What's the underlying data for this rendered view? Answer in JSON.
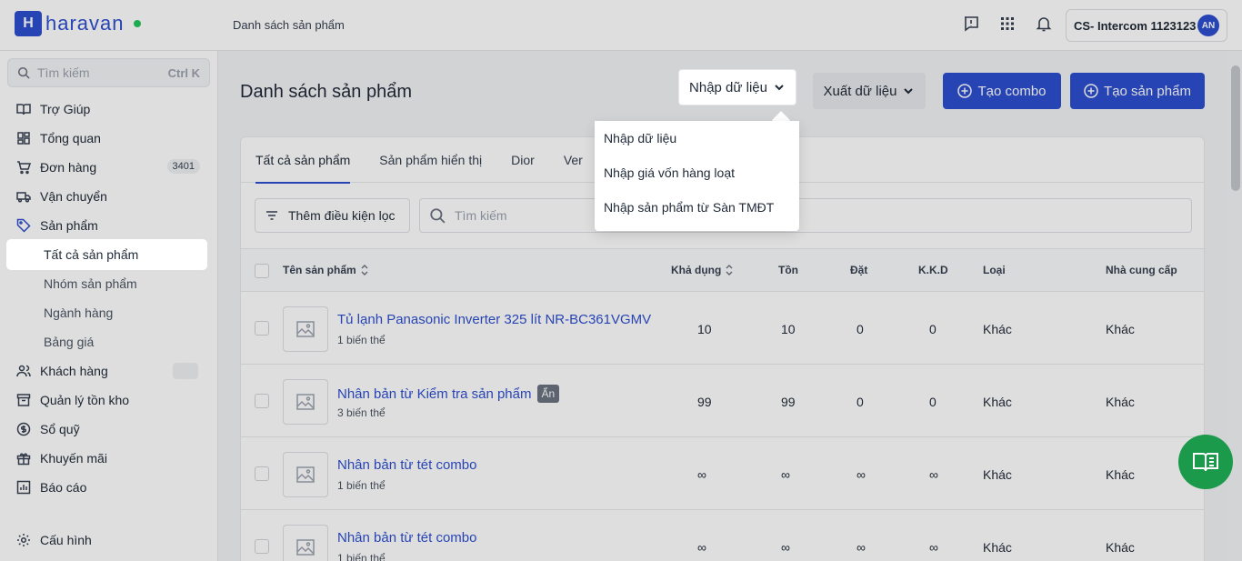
{
  "brand": {
    "name": "haravan"
  },
  "header": {
    "breadcrumb": "Danh sách sản phẩm",
    "account_name": "CS- Intercom 1123123",
    "avatar_initials": "AN"
  },
  "sidebar": {
    "search_placeholder": "Tìm kiếm",
    "search_shortcut": "Ctrl K",
    "items": [
      {
        "label": "Trợ Giúp",
        "icon": "book-icon"
      },
      {
        "label": "Tổng quan",
        "icon": "dashboard-icon"
      },
      {
        "label": "Đơn hàng",
        "icon": "cart-icon",
        "badge": "3401"
      },
      {
        "label": "Vận chuyển",
        "icon": "truck-icon"
      },
      {
        "label": "Sản phẩm",
        "icon": "tag-icon"
      }
    ],
    "product_sub": [
      "Tất cả sản phẩm",
      "Nhóm sản phẩm",
      "Ngành hàng",
      "Bảng giá"
    ],
    "items2": [
      {
        "label": "Khách hàng",
        "icon": "users-icon"
      },
      {
        "label": "Quản lý tồn kho",
        "icon": "archive-icon"
      },
      {
        "label": "Sổ quỹ",
        "icon": "dollar-icon"
      },
      {
        "label": "Khuyến mãi",
        "icon": "gift-icon"
      },
      {
        "label": "Báo cáo",
        "icon": "chart-icon"
      }
    ],
    "settings_label": "Cấu hình"
  },
  "main": {
    "title": "Danh sách sản phẩm",
    "import_label": "Nhập dữ liệu",
    "export_label": "Xuất dữ liệu",
    "combo_label": "Tạo combo",
    "create_label": "Tạo sản phẩm",
    "tabs": [
      "Tất cả sản phẩm",
      "Sản phẩm hiển thị",
      "Dior",
      "Ver"
    ],
    "filter_label": "Thêm điều kiện lọc",
    "search_placeholder": "Tìm kiếm",
    "columns": [
      "Tên sản phẩm",
      "Khả dụng",
      "Tồn",
      "Đặt",
      "K.K.D",
      "Loại",
      "Nhà cung cấp"
    ],
    "rows": [
      {
        "name": "Tủ lạnh Panasonic Inverter 325 lít NR-BC361VGMV",
        "variants": "1 biến thể",
        "available": "10",
        "stock": "10",
        "ordered": "0",
        "kkd": "0",
        "type": "Khác",
        "vendor": "Khác",
        "tag": ""
      },
      {
        "name": "Nhân bản từ Kiểm tra sản phẩm",
        "variants": "3 biến thể",
        "available": "99",
        "stock": "99",
        "ordered": "0",
        "kkd": "0",
        "type": "Khác",
        "vendor": "Khác",
        "tag": "Ẩn"
      },
      {
        "name": "Nhân bản từ tét combo",
        "variants": "1 biến thể",
        "available": "∞",
        "stock": "∞",
        "ordered": "∞",
        "kkd": "∞",
        "type": "Khác",
        "vendor": "Khác",
        "tag": ""
      },
      {
        "name": "Nhân bản từ tét combo",
        "variants": "1 biến thể",
        "available": "∞",
        "stock": "∞",
        "ordered": "∞",
        "kkd": "∞",
        "type": "Khác",
        "vendor": "Khác",
        "tag": ""
      }
    ]
  },
  "import_menu": [
    "Nhập dữ liệu",
    "Nhập giá vốn hàng loạt",
    "Nhập sản phẩm từ Sàn TMĐT"
  ],
  "colors": {
    "primary": "#2d4fd0",
    "fab": "#1a9a4a"
  }
}
